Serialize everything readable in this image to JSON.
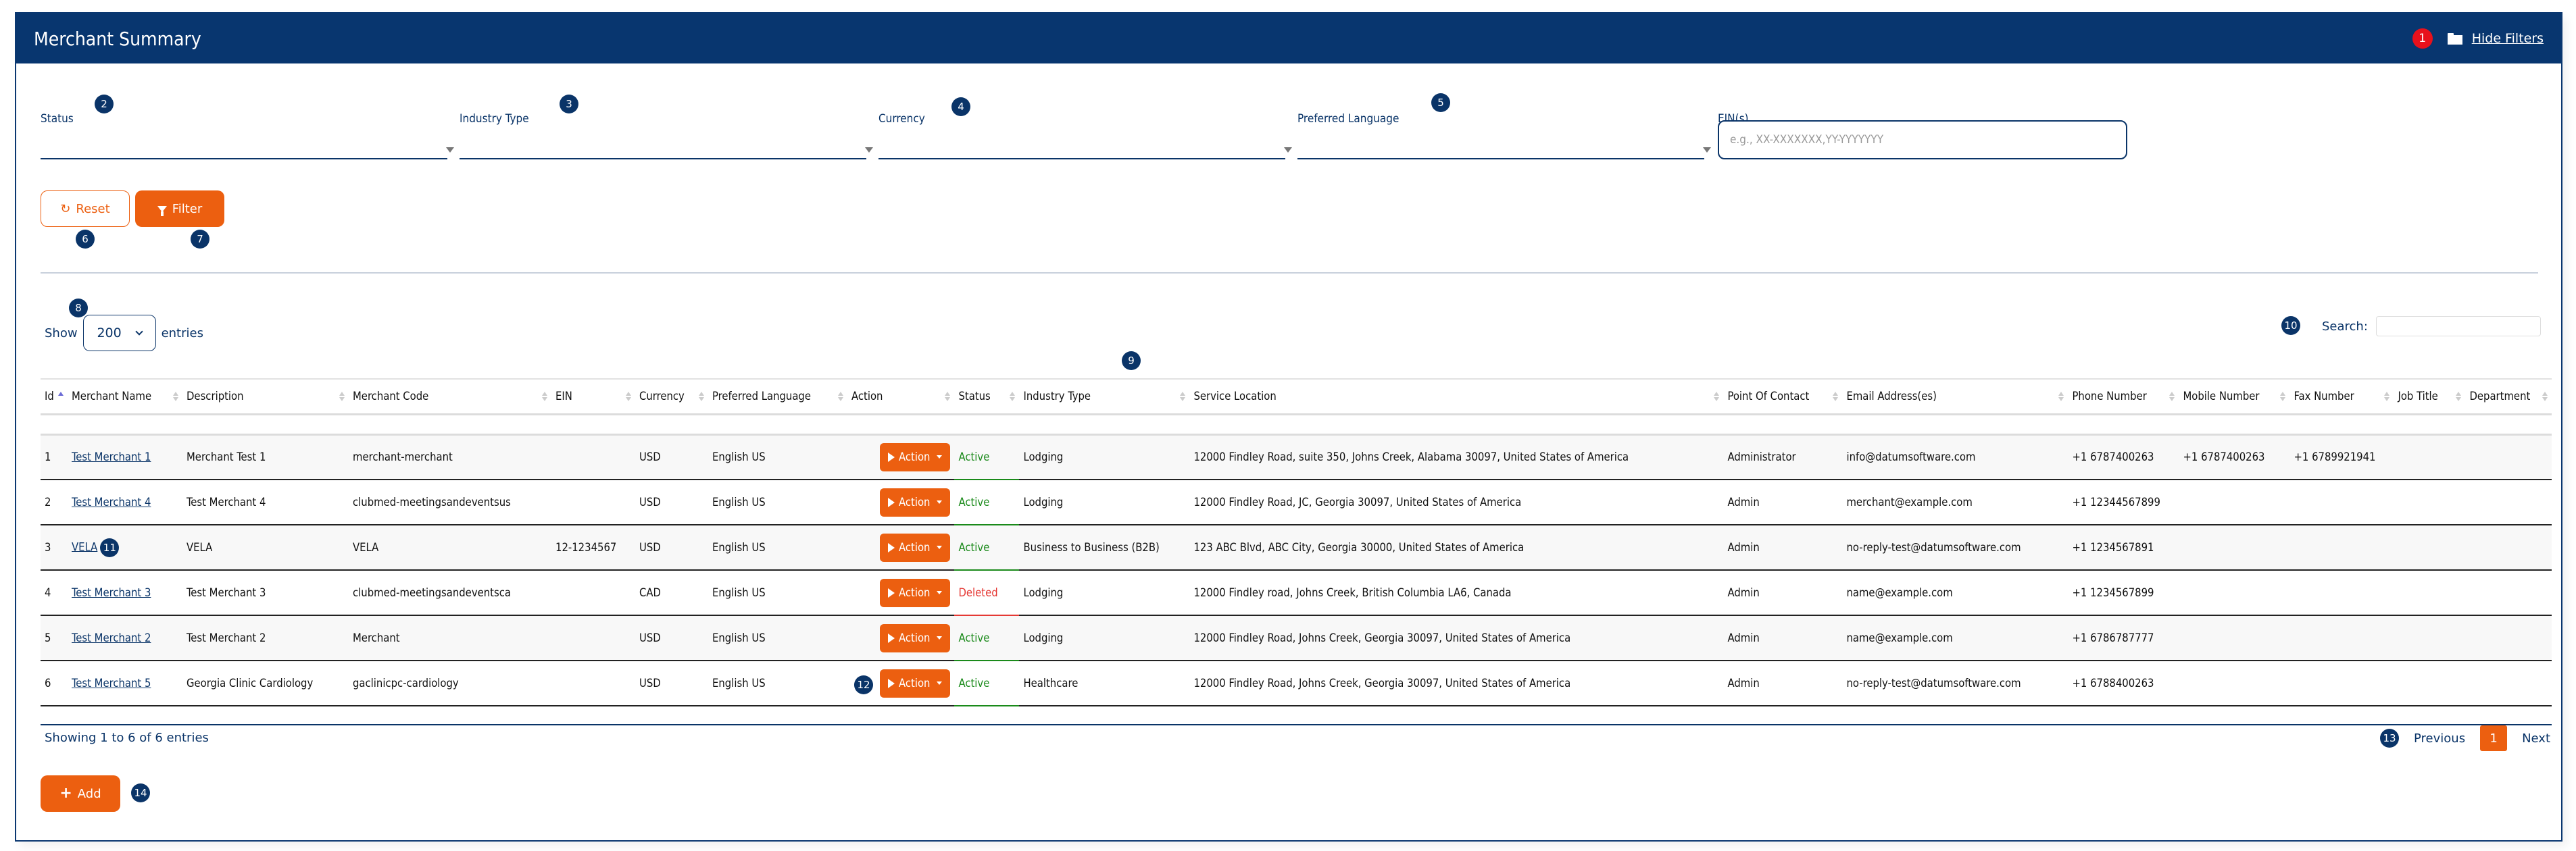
{
  "header": {
    "title": "Merchant Summary",
    "notification_badge": "1",
    "hide_filters_label": "Hide Filters",
    "hide_filters_icon": "folder-icon"
  },
  "filters": {
    "status": {
      "label": "Status",
      "value": "",
      "callout": "2"
    },
    "industry_type": {
      "label": "Industry Type",
      "value": "",
      "callout": "3"
    },
    "currency": {
      "label": "Currency",
      "value": "",
      "callout": "4"
    },
    "preferred_language": {
      "label": "Preferred Language",
      "value": "",
      "callout": "5"
    },
    "ein": {
      "label": "EIN(s)",
      "value": "",
      "placeholder": "e.g., XX-XXXXXXX,YY-YYYYYYY"
    },
    "reset_label": "Reset",
    "reset_icon": "refresh-icon",
    "reset_callout": "6",
    "filter_label": "Filter",
    "filter_icon": "funnel-icon",
    "filter_callout": "7"
  },
  "table_controls": {
    "show_label": "Show",
    "entries_label": "entries",
    "page_length": "200",
    "length_callout": "8",
    "table_callout": "9",
    "search_label": "Search:",
    "search_value": "",
    "search_callout": "10"
  },
  "table": {
    "columns": [
      "Id",
      "Merchant Name",
      "Description",
      "Merchant Code",
      "EIN",
      "Currency",
      "Preferred Language",
      "Action",
      "Status",
      "Industry Type",
      "Service Location",
      "Point Of Contact",
      "Email Address(es)",
      "Phone Number",
      "Mobile Number",
      "Fax Number",
      "Job Title",
      "Department"
    ],
    "sorted_column": "Id",
    "sort_direction": "asc",
    "action_label": "Action",
    "rows": [
      {
        "id": "1",
        "merchant_name": "Test Merchant 1",
        "description": "Merchant Test 1",
        "merchant_code": "merchant-merchant",
        "ein": "",
        "currency": "USD",
        "language": "English US",
        "status": "Active",
        "industry": "Lodging",
        "location": "12000 Findley Road, suite 350, Johns Creek, Alabama 30097, United States of America",
        "contact": "Administrator",
        "email": "info@datumsoftware.com",
        "phone": "+1 6787400263",
        "mobile": "+1 6787400263",
        "fax": "+1 6789921941",
        "job_title": "",
        "department": ""
      },
      {
        "id": "2",
        "merchant_name": "Test Merchant 4",
        "description": "Test Merchant 4",
        "merchant_code": "clubmed-meetingsandeventsus",
        "ein": "",
        "currency": "USD",
        "language": "English US",
        "status": "Active",
        "industry": "Lodging",
        "location": "12000 Findley Road, JC, Georgia 30097, United States of America",
        "contact": "Admin",
        "email": "merchant@example.com",
        "phone": "+1 12344567899",
        "mobile": "",
        "fax": "",
        "job_title": "",
        "department": ""
      },
      {
        "id": "3",
        "merchant_name": "VELA",
        "description": "VELA",
        "merchant_code": "VELA",
        "ein": "12-1234567",
        "currency": "USD",
        "language": "English US",
        "status": "Active",
        "industry": "Business to Business (B2B)",
        "location": "123 ABC Blvd, ABC City, Georgia 30000, United States of America",
        "contact": "Admin",
        "email": "no-reply-test@datumsoftware.com",
        "phone": "+1 1234567891",
        "mobile": "",
        "fax": "",
        "job_title": "",
        "department": "",
        "name_callout": "11"
      },
      {
        "id": "4",
        "merchant_name": "Test Merchant 3",
        "description": "Test Merchant 3",
        "merchant_code": "clubmed-meetingsandeventsca",
        "ein": "",
        "currency": "CAD",
        "language": "English US",
        "status": "Deleted",
        "industry": "Lodging",
        "location": "12000 Findley road, Johns Creek, British Columbia LA6, Canada",
        "contact": "Admin",
        "email": "name@example.com",
        "phone": "+1 1234567899",
        "mobile": "",
        "fax": "",
        "job_title": "",
        "department": ""
      },
      {
        "id": "5",
        "merchant_name": "Test Merchant 2",
        "description": "Test Merchant 2",
        "merchant_code": "Merchant",
        "ein": "",
        "currency": "USD",
        "language": "English US",
        "status": "Active",
        "industry": "Lodging",
        "location": "12000 Findley Road, Johns Creek, Georgia 30097, United States of America",
        "contact": "Admin",
        "email": "name@example.com",
        "phone": "+1 6786787777",
        "mobile": "",
        "fax": "",
        "job_title": "",
        "department": ""
      },
      {
        "id": "6",
        "merchant_name": "Test Merchant 5",
        "description": "Georgia Clinic Cardiology",
        "merchant_code": "gaclinicpc-cardiology",
        "ein": "",
        "currency": "USD",
        "language": "English US",
        "status": "Active",
        "industry": "Healthcare",
        "location": "12000 Findley Road, Johns Creek, Georgia 30097, United States of America",
        "contact": "Admin",
        "email": "no-reply-test@datumsoftware.com",
        "phone": "+1 6788400263",
        "mobile": "",
        "fax": "",
        "job_title": "",
        "department": "",
        "action_callout": "12"
      }
    ]
  },
  "footer": {
    "info": "Showing 1 to 6 of 6 entries",
    "pagination_callout": "13",
    "previous_label": "Previous",
    "current_page": "1",
    "next_label": "Next",
    "add_label": "Add",
    "add_icon": "plus-icon",
    "add_callout": "14"
  },
  "colors": {
    "brand_navy": "#08366f",
    "accent_orange": "#ec5f10",
    "status_active": "#1a8a1a",
    "status_deleted": "#e53935",
    "badge_red": "#e8111c"
  }
}
